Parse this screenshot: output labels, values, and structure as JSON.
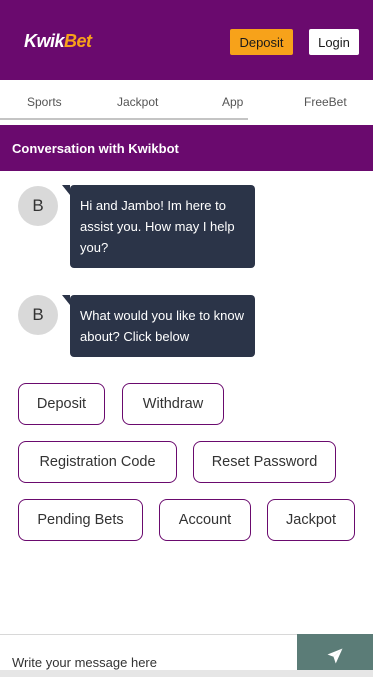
{
  "header": {
    "logo_main": "Kwik",
    "logo_accent": "Bet",
    "deposit_label": "Deposit",
    "login_label": "Login"
  },
  "tabs": [
    {
      "label": "Sports"
    },
    {
      "label": "Jackpot"
    },
    {
      "label": "App"
    },
    {
      "label": "FreeBet"
    }
  ],
  "conversation": {
    "title": "Conversation with Kwikbot",
    "messages": [
      {
        "avatar": "B",
        "text": "Hi and Jambo! Im here to assist you. How may I help you?"
      },
      {
        "avatar": "B",
        "text": "What would you like to know about? Click below"
      }
    ]
  },
  "quick_replies": [
    {
      "label": "Deposit"
    },
    {
      "label": "Withdraw"
    },
    {
      "label": "Registration Code"
    },
    {
      "label": "Reset Password"
    },
    {
      "label": "Pending Bets"
    },
    {
      "label": "Account"
    },
    {
      "label": "Jackpot"
    }
  ],
  "composer": {
    "placeholder": "Write your message here",
    "send_icon": "paper-plane-icon"
  },
  "colors": {
    "brand_purple": "#6a0a6e",
    "accent_orange": "#f7a21a",
    "bubble_navy": "#2b3448",
    "send_teal": "#5b7c77"
  }
}
